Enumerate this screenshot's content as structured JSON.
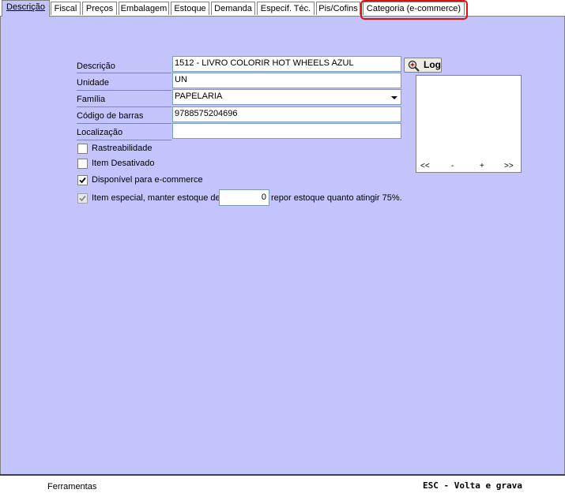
{
  "tabs": [
    {
      "label": "Descrição",
      "active": true
    },
    {
      "label": "Fiscal"
    },
    {
      "label": "Preços"
    },
    {
      "label": "Embalagem"
    },
    {
      "label": "Estoque"
    },
    {
      "label": "Demanda"
    },
    {
      "label": "Especif. Téc."
    },
    {
      "label": "Pis/Cofins"
    },
    {
      "label": "Categoria (e-commerce)",
      "highlighted": true
    }
  ],
  "form": {
    "descricao": {
      "label": "Descrição",
      "value": "1512 - LIVRO COLORIR HOT WHEELS AZUL"
    },
    "unidade": {
      "label": "Unidade",
      "value": "UN"
    },
    "familia": {
      "label": "Família",
      "value": "PAPELARIA"
    },
    "codigo_barras": {
      "label": "Código de barras",
      "value": "9788575204696"
    },
    "localizacao": {
      "label": "Localização",
      "value": ""
    }
  },
  "log_button": {
    "label": "Log",
    "icon": "magnifier-plus-icon"
  },
  "image_nav": {
    "first": "<<",
    "minus": "-",
    "plus": "+",
    "last": ">>"
  },
  "checkboxes": {
    "rastreabilidade": {
      "label": "Rastreabilidade",
      "checked": false
    },
    "item_desativado": {
      "label": "Item Desativado",
      "checked": false
    },
    "ecommerce": {
      "label": "Disponível para e-commerce",
      "checked": true
    },
    "item_especial": {
      "label": "Item especial, manter estoque de",
      "checked": true,
      "disabled": true
    }
  },
  "estoque": {
    "value": "0",
    "suffix": "repor estoque quanto atingir 75%."
  },
  "statusbar": {
    "left": "Ferramentas",
    "right": "ESC - Volta e grava"
  },
  "colors": {
    "panel": "#c4c4fc",
    "highlight": "#e01010"
  }
}
